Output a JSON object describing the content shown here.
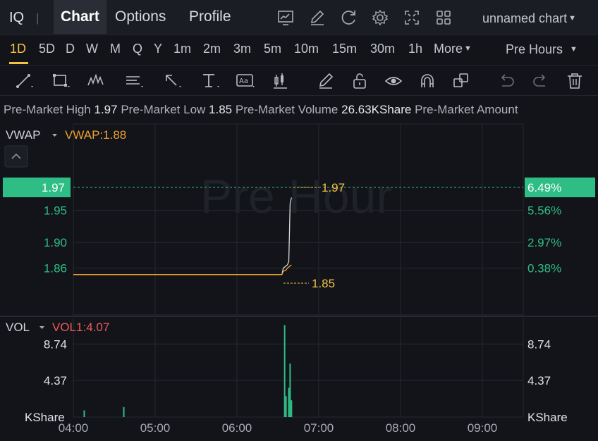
{
  "header": {
    "ticker": "IQ",
    "separator": "|",
    "tabs": [
      {
        "label": "Chart",
        "active": true
      },
      {
        "label": "Options",
        "active": false
      },
      {
        "label": "Profile",
        "active": false
      }
    ],
    "chart_name": "unnamed chart",
    "icons": [
      "chart-type-icon",
      "draw-pen-icon",
      "refresh-icon",
      "settings-gear-icon",
      "fullscreen-icon",
      "layout-grid-icon"
    ]
  },
  "intervals": {
    "items": [
      "1D",
      "5D",
      "D",
      "W",
      "M",
      "Q",
      "Y",
      "1m",
      "2m",
      "3m",
      "5m",
      "10m",
      "15m",
      "30m",
      "1h",
      "More"
    ],
    "active": "1D",
    "session": "Pre Hours"
  },
  "drawing_tools": [
    "trend-line-icon",
    "rectangle-icon",
    "wave-pattern-icon",
    "fib-lines-icon",
    "arrow-icon",
    "text-tool-icon",
    "annotation-icon",
    "candle-icon",
    "pencil-icon",
    "lock-icon",
    "eye-icon",
    "magnet-icon",
    "duplicate-icon",
    "undo-icon",
    "redo-icon",
    "trash-icon"
  ],
  "stats": [
    {
      "label": "Pre-Market High",
      "value": "1.97"
    },
    {
      "label": "Pre-Market Low",
      "value": "1.85"
    },
    {
      "label": "Pre-Market Volume",
      "value": "26.63KShare"
    },
    {
      "label": "Pre-Market Amount",
      "value": ""
    }
  ],
  "price_panel": {
    "indicator": "VWAP",
    "indicator_value": "VWAP:1.88",
    "watermark": "Pre Hour",
    "current_price_label": "1.97",
    "current_pct_label": "6.49%",
    "high_label": "1.97",
    "low_label": "1.85"
  },
  "volume_panel": {
    "indicator": "VOL",
    "indicator_value": "VOL1:4.07",
    "unit": "KShare"
  },
  "colors": {
    "up": "#2ebd85",
    "price_line": "#d8d8d8",
    "vwap": "#f0a030",
    "annotation": "#f5c242",
    "vol_label": "#ec5b5b"
  },
  "chart_data": {
    "type": "line",
    "x_ticks": [
      "04:00",
      "05:00",
      "06:00",
      "07:00",
      "08:00",
      "09:00"
    ],
    "x_range": [
      "04:00",
      "09:30"
    ],
    "price_axis": {
      "ticks": [
        "1.95",
        "1.90",
        "1.86"
      ],
      "tick_values": [
        1.95,
        1.9,
        1.86
      ],
      "ylim": [
        1.8365,
        1.9858
      ]
    },
    "percent_axis": {
      "ticks": [
        "5.56%",
        "2.97%",
        "0.38%"
      ],
      "tick_values": [
        1.95,
        1.9,
        1.86
      ]
    },
    "series": [
      {
        "name": "Price",
        "points": [
          {
            "t": "04:00",
            "y": 1.85
          },
          {
            "t": "06:33",
            "y": 1.85
          },
          {
            "t": "06:34",
            "y": 1.86
          },
          {
            "t": "06:37",
            "y": 1.865
          },
          {
            "t": "06:38",
            "y": 1.87
          },
          {
            "t": "06:39",
            "y": 1.96
          },
          {
            "t": "06:40",
            "y": 1.97
          }
        ]
      },
      {
        "name": "VWAP",
        "points": [
          {
            "t": "04:00",
            "y": 1.85
          },
          {
            "t": "06:33",
            "y": 1.85
          },
          {
            "t": "06:34",
            "y": 1.855
          },
          {
            "t": "06:36",
            "y": 1.857
          },
          {
            "t": "06:37",
            "y": 1.86
          },
          {
            "t": "06:40",
            "y": 1.865
          }
        ]
      }
    ],
    "volume": {
      "ticks": [
        "8.74",
        "4.37"
      ],
      "tick_values": [
        8.74,
        4.37
      ],
      "ylim": [
        0,
        11.8
      ],
      "bars": [
        {
          "t": "04:08",
          "v": 0.8
        },
        {
          "t": "04:37",
          "v": 1.2
        },
        {
          "t": "06:35",
          "v": 11.0
        },
        {
          "t": "06:36",
          "v": 2.5
        },
        {
          "t": "06:38",
          "v": 3.5
        },
        {
          "t": "06:39",
          "v": 6.4
        },
        {
          "t": "06:40",
          "v": 2.0
        }
      ]
    }
  }
}
